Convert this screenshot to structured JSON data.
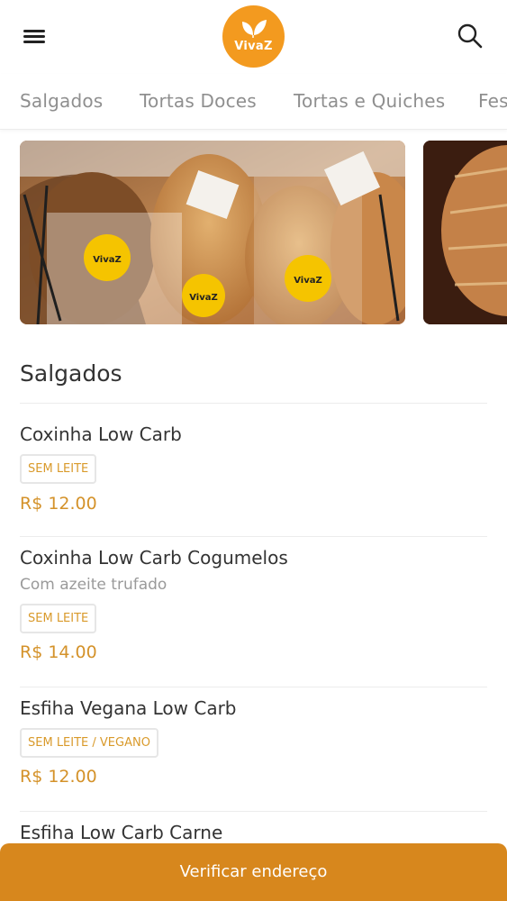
{
  "header": {
    "logo_text": "VivaZ",
    "menu_icon": "hamburger-menu-icon",
    "search_icon": "search-icon",
    "brand_color": "#f39a1f"
  },
  "tabs": [
    {
      "label": "Salgados"
    },
    {
      "label": "Tortas Doces"
    },
    {
      "label": "Tortas e Quiches"
    },
    {
      "label": "Festas"
    }
  ],
  "banner": {
    "sticker_text": "VivaZ"
  },
  "section": {
    "title": "Salgados"
  },
  "products": [
    {
      "name": "Coxinha Low Carb",
      "description": "",
      "tag": "SEM LEITE",
      "price": "R$ 12.00"
    },
    {
      "name": "Coxinha Low Carb Cogumelos",
      "description": "Com azeite trufado",
      "tag": "SEM LEITE",
      "price": "R$ 14.00"
    },
    {
      "name": "Esfiha Vegana Low Carb",
      "description": "",
      "tag": "SEM LEITE / VEGANO",
      "price": "R$ 12.00"
    },
    {
      "name": "Esfiha Low Carb Carne",
      "description": "",
      "tag": "",
      "price": ""
    }
  ],
  "bottom_bar": {
    "label": "Verificar endereço",
    "color": "#d7871d"
  }
}
